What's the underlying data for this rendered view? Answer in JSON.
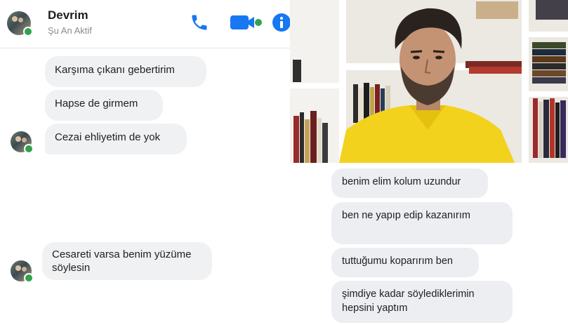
{
  "header": {
    "contact_name": "Devrim",
    "status": "Şu An Aktif",
    "icons": [
      "phone-icon",
      "video-camera-icon",
      "info-icon"
    ],
    "accent_color": "#1877f2",
    "online_color": "#31a24c"
  },
  "messages_left": [
    "Karşıma çıkanı gebertirim",
    "Hapse de girmem",
    "Cezai ehliyetim de yok",
    "Cesareti varsa benim yüzüme söylesin"
  ],
  "messages_right": [
    "benim elim kolum uzundur",
    "ben ne yapıp edip kazanırım",
    "tuttuğumu koparırım ben",
    "şimdiye kadar söylediklerimin hepsini yaptım"
  ]
}
